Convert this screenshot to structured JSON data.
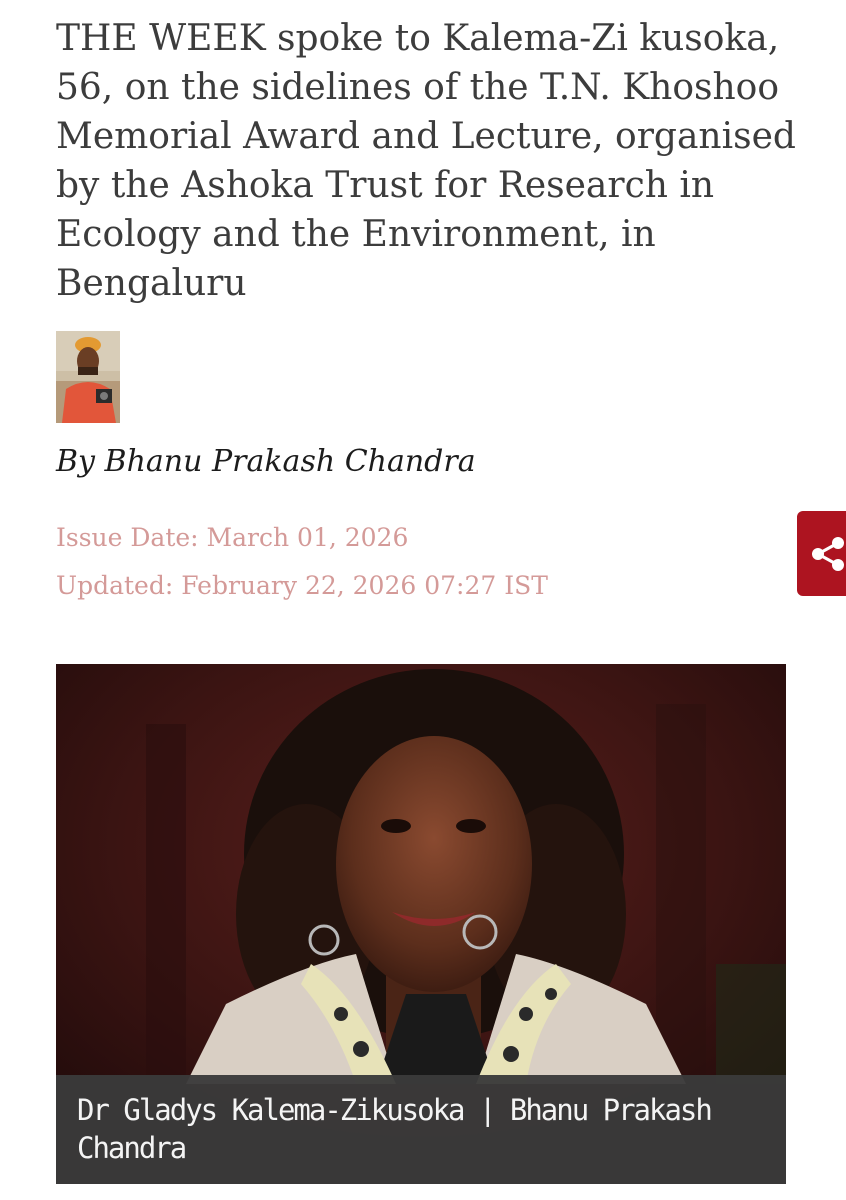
{
  "article": {
    "dek": "THE WEEK spoke to Kalema-Zi kusoka, 56, on the sidelines of the T.N. Khoshoo Memorial Award and Lecture, organised by the Ashoka Trust for Research in Ecology and the Environment, in Bengaluru",
    "byline": "By Bhanu Prakash Chandra",
    "issue_date": "Issue Date: March 01, 2026",
    "updated": "Updated: February 22, 2026 07:27 IST"
  },
  "hero": {
    "caption": "Dr Gladys Kalema-Zikusoka | Bhanu Prakash Chandra"
  },
  "icons": {
    "share": "share-icon",
    "author_photo": "author-avatar"
  },
  "colors": {
    "text": "#3c3c3c",
    "byline": "#1c1c1c",
    "meta": "#d49a98",
    "share_bg": "#ad1420",
    "caption_bg": "#3a3a3a"
  }
}
